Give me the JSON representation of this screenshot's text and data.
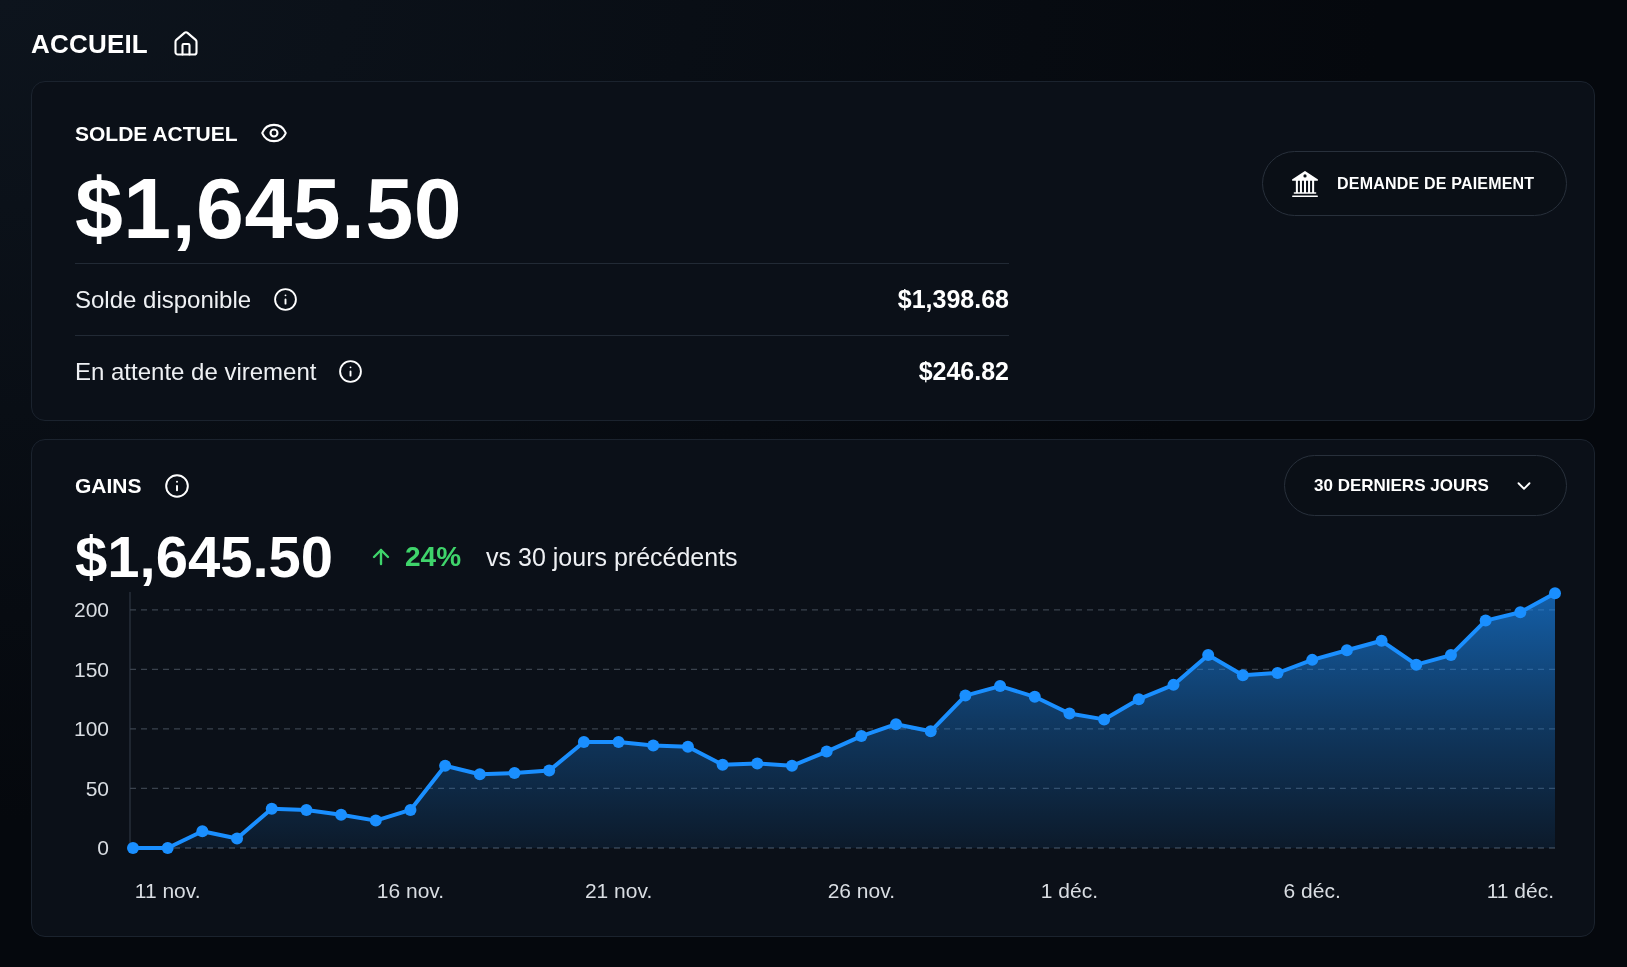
{
  "page": {
    "title": "ACCUEIL"
  },
  "balance": {
    "label": "SOLDE ACTUEL",
    "amount": "$1,645.50",
    "rows": [
      {
        "label": "Solde disponible",
        "value": "$1,398.68"
      },
      {
        "label": "En attente de virement",
        "value": "$246.82"
      }
    ],
    "action": {
      "label": "DEMANDE DE PAIEMENT"
    }
  },
  "earnings": {
    "title": "GAINS",
    "period": {
      "label": "30 DERNIERS JOURS"
    },
    "amount": "$1,645.50",
    "change": {
      "positive": true,
      "value": "24%",
      "caption": "vs 30 jours précédents"
    },
    "chart_data": {
      "type": "area",
      "categories": [
        null,
        "11 nov.",
        null,
        null,
        null,
        null,
        null,
        null,
        "16 nov.",
        null,
        null,
        null,
        null,
        null,
        "21 nov.",
        null,
        null,
        null,
        null,
        null,
        null,
        "26 nov.",
        null,
        null,
        null,
        null,
        null,
        "1 déc.",
        null,
        null,
        null,
        null,
        null,
        null,
        "6 déc.",
        null,
        null,
        null,
        null,
        null,
        "11 déc.",
        null
      ],
      "series": [
        {
          "color": "#1a8fff",
          "values": [
            0,
            0,
            14,
            8,
            33,
            32,
            28,
            23,
            32,
            69,
            62,
            63,
            65,
            89,
            89,
            86,
            85,
            70,
            71,
            69,
            81,
            94,
            104,
            98,
            128,
            136,
            127,
            113,
            108,
            125,
            137,
            162,
            145,
            147,
            158,
            166,
            174,
            154,
            162,
            191,
            198,
            214
          ]
        }
      ],
      "ylim": [
        0,
        215
      ],
      "yticks": [
        0,
        50,
        100,
        150,
        200
      ],
      "grid": true
    }
  }
}
